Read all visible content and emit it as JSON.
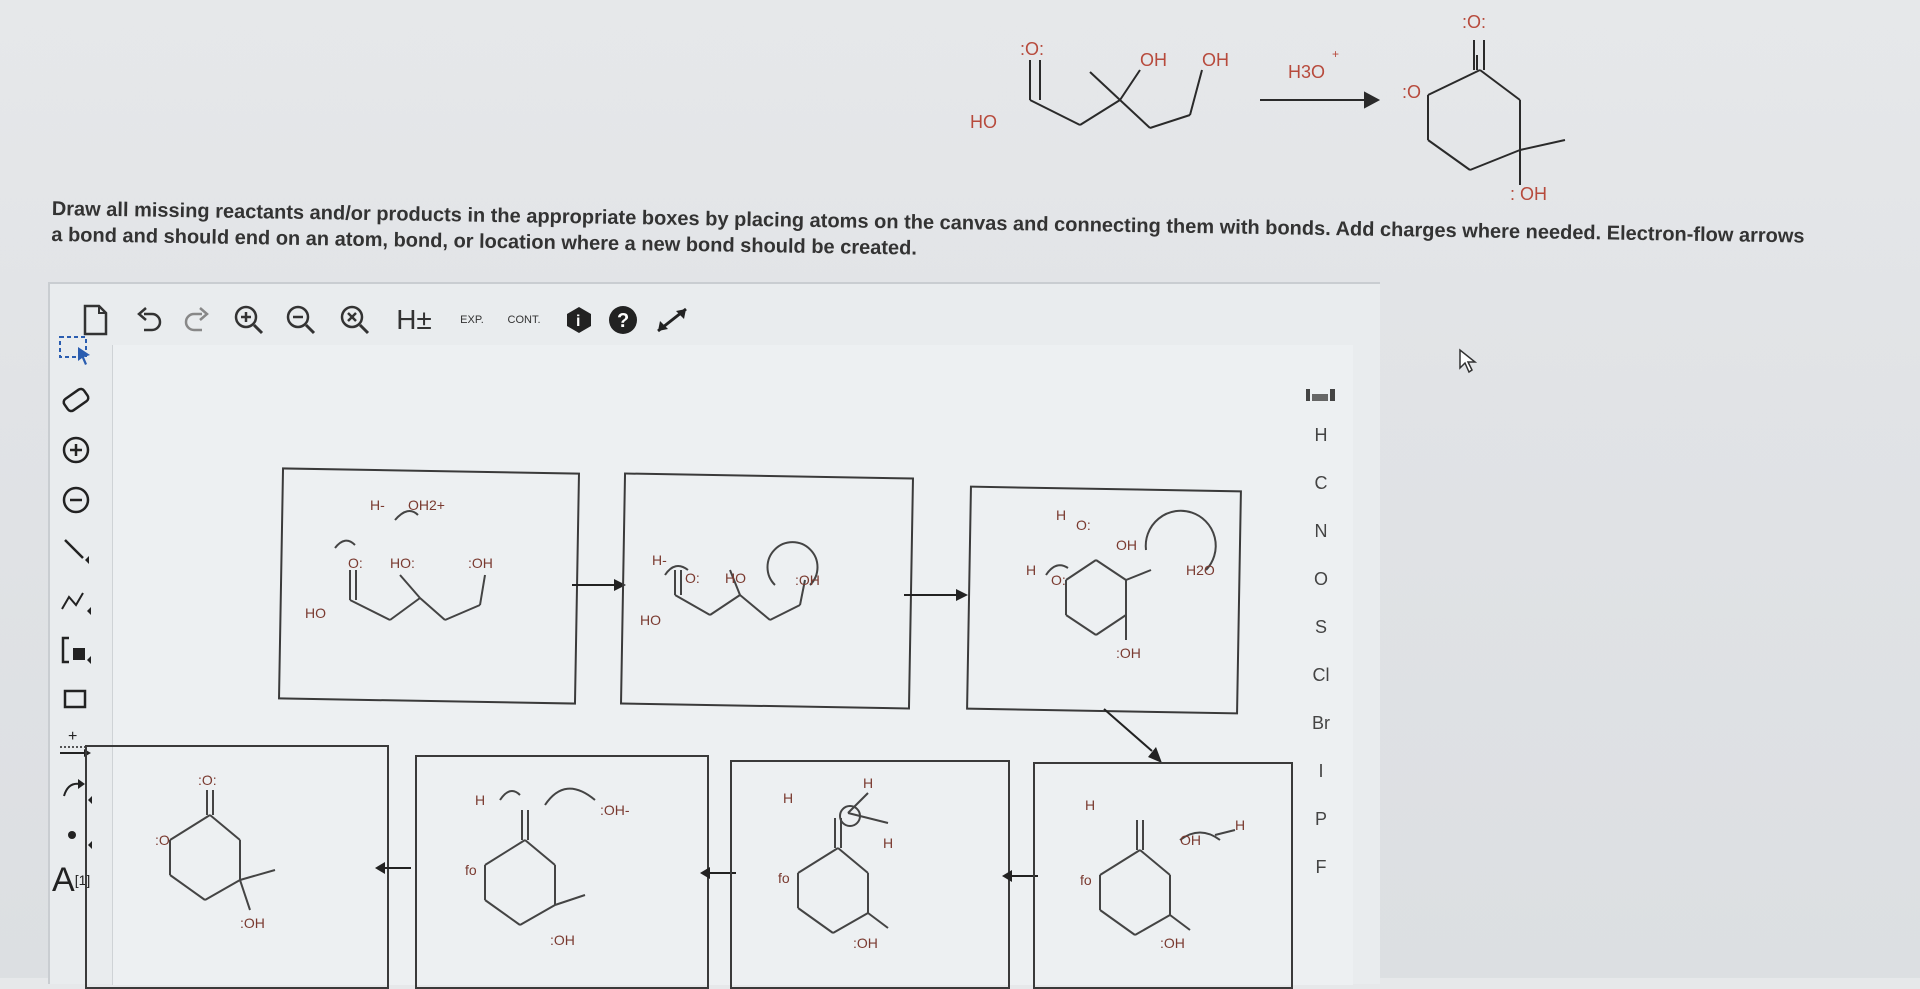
{
  "reaction": {
    "reactant_oxygen": ":O:",
    "reactant_ho": "HO",
    "reactant_oh1": "OH",
    "reactant_oh2": "OH",
    "reagent": "H3O",
    "reagent_charge": "+",
    "product_oxygen_top": ":O:",
    "product_oxygen_ring": ":O",
    "product_oh": ": OH"
  },
  "instructions": {
    "line1": "Draw all missing reactants and/or products in the appropriate boxes by placing atoms on the canvas and connecting them with bonds. Add charges where needed. Electron-flow arrows",
    "line2": "a bond and should end on an atom, bond, or location where a new bond should be created."
  },
  "toolbar": {
    "new_icon": "document-icon",
    "undo_icon": "undo-icon",
    "redo_icon": "redo-icon",
    "zoom_in_icon": "zoom-in-icon",
    "zoom_out_icon": "zoom-out-icon",
    "clear_icon": "clear-icon",
    "h_label": "H±",
    "exp_label": "EXP.",
    "cont_label": "CONT.",
    "info_icon": "info-icon",
    "help_icon": "help-icon",
    "expand_icon": "expand-icon"
  },
  "left_tools": [
    {
      "name": "select-tool",
      "icon": "select-icon"
    },
    {
      "name": "eraser-tool",
      "icon": "eraser-icon"
    },
    {
      "name": "positive-charge-tool",
      "icon": "plus-circle-icon"
    },
    {
      "name": "negative-charge-tool",
      "icon": "minus-circle-icon"
    },
    {
      "name": "single-bond-tool",
      "icon": "bond-icon"
    },
    {
      "name": "chain-tool",
      "icon": "chain-icon"
    },
    {
      "name": "bracket-tool",
      "icon": "bracket-icon"
    },
    {
      "name": "rectangle-tool",
      "icon": "rectangle-icon"
    },
    {
      "name": "reaction-arrow-tool",
      "icon": "reaction-arrow-icon"
    },
    {
      "name": "curved-arrow-tool",
      "icon": "curved-arrow-icon"
    },
    {
      "name": "lone-pair-tool",
      "icon": "dot-icon"
    },
    {
      "name": "text-tool",
      "label": "A",
      "superscript": "[1]"
    }
  ],
  "atom_panel": [
    "H",
    "C",
    "N",
    "O",
    "S",
    "Cl",
    "Br",
    "I",
    "P",
    "F"
  ],
  "box_labels": {
    "box1": {
      "h_oh2": "H-",
      "oh2": "OH2+",
      "o1": "O:",
      "ho1": "HO:",
      "oh1": ":OH",
      "ho_left": "HO"
    },
    "box2": {
      "h": "H-",
      "o1": "O:",
      "ho": "HO",
      "oh": ":OH",
      "ho_left": "HO"
    },
    "box3": {
      "h1": "H",
      "o1": "O:",
      "oh_top": "OH",
      "h2": "H",
      "o2": "O:",
      "h2o": "H2O",
      "oh": ":OH"
    },
    "box4": {
      "o_top": ":O:",
      "o_ring": ":O",
      "oh": ":OH"
    },
    "box5": {
      "h": "H",
      "fo": "fo",
      "oh_minus": ":OH-",
      "oh": ":OH"
    },
    "box6": {
      "h1": "H",
      "fo": "fo",
      "h2": "H",
      "h3": "H",
      "oh": ":OH"
    },
    "box7": {
      "h1": "H",
      "fo": "fo",
      "oh_h": "OH",
      "h2": "H",
      "oh": ":OH"
    }
  }
}
